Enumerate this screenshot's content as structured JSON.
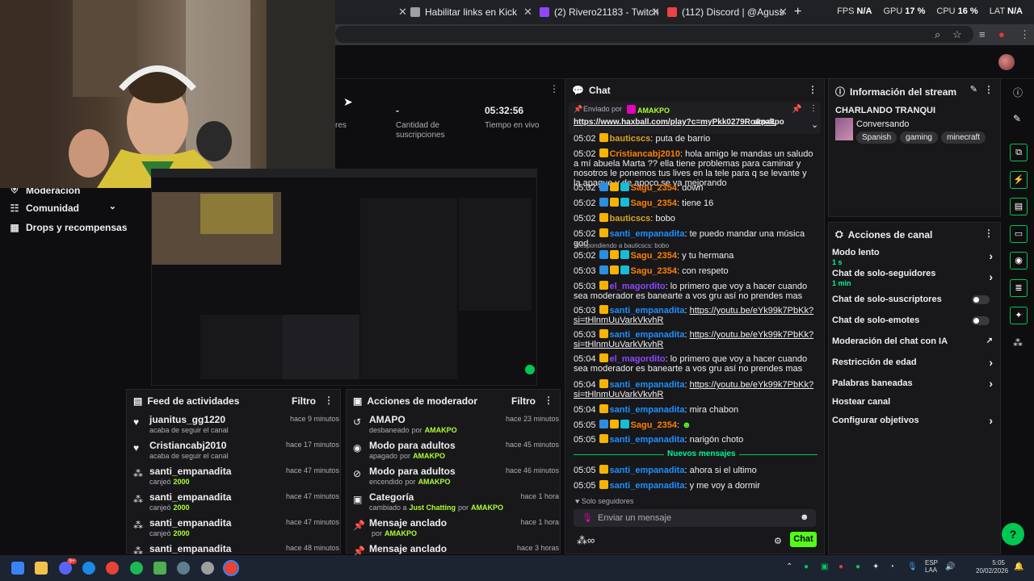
{
  "browser": {
    "tabs": [
      {
        "label": "Habilitar links en Kick",
        "color": "#9aa0a6"
      },
      {
        "label": "(2) Rivero21183 - Twitch",
        "color": "#9146ff"
      },
      {
        "label": "(112) Discord | @Aguss",
        "color": "#5865f2"
      }
    ],
    "new_tab_icon": "+",
    "perf": {
      "fps_label": "FPS",
      "fps": "N/A",
      "gpu_label": "GPU",
      "gpu": "17 %",
      "cpu_label": "CPU",
      "cpu": "16 %",
      "lat_label": "LAT",
      "lat": "N/A"
    }
  },
  "stats": {
    "subs_value": "-",
    "subs_label_1": "Cantidad de",
    "subs_label_2": "suscripciones",
    "live_value": "05:32:56",
    "live_label": "Tiempo en vivo",
    "partial_label": "res"
  },
  "nav": {
    "moderation": "Moderación",
    "community": "Comunidad",
    "drops": "Drops y recompensas"
  },
  "activity_feed": {
    "title": "Feed de actividades",
    "filter": "Filtro",
    "items": [
      {
        "icon": "heart-icon",
        "name": "juanitus_gg1220",
        "sub": "acaba de seguir el canal",
        "time": "hace 9 minutos"
      },
      {
        "icon": "heart-icon",
        "name": "Cristiancabj2010",
        "sub": "acaba de seguir el canal",
        "time": "hace 17 minutos"
      },
      {
        "icon": "points-icon",
        "name": "santi_empanadita",
        "sub": "canjeó",
        "amount": "2000",
        "time": "hace 47 minutos"
      },
      {
        "icon": "points-icon",
        "name": "santi_empanadita",
        "sub": "canjeó",
        "amount": "2000",
        "time": "hace 47 minutos"
      },
      {
        "icon": "points-icon",
        "name": "santi_empanadita",
        "sub": "canjeó",
        "amount": "2000",
        "time": "hace 47 minutos"
      },
      {
        "icon": "points-icon",
        "name": "santi_empanadita",
        "sub": "",
        "amount": "",
        "time": "hace 48 minutos"
      }
    ]
  },
  "mod_actions": {
    "title": "Acciones de moderador",
    "filter": "Filtro",
    "items": [
      {
        "icon": "undo-icon",
        "name": "AMAPO",
        "sub": "desbaneado",
        "by": "por",
        "who": "AMAKPO",
        "time": "hace 23 minutos"
      },
      {
        "icon": "eye-icon",
        "name": "Modo para adultos",
        "sub": "apagado",
        "by": "por",
        "who": "AMAKPO",
        "time": "hace 45 minutos"
      },
      {
        "icon": "eye-off-icon",
        "name": "Modo para adultos",
        "sub": "encendido",
        "by": "por",
        "who": "AMAKPO",
        "time": "hace 46 minutos"
      },
      {
        "icon": "category-icon",
        "name": "Categoría",
        "sub": "cambiado a",
        "extra": "Just Chatting",
        "by": "por",
        "who": "AMAKPO",
        "time": "hace 1 hora"
      },
      {
        "icon": "pin-icon",
        "name": "Mensaje anclado",
        "sub": "",
        "by": "por",
        "who": "AMAKPO",
        "time": "hace 1 hora"
      },
      {
        "icon": "pin-icon",
        "name": "Mensaje anclado",
        "sub": "",
        "by": "",
        "who": "",
        "time": "hace 3 horas"
      }
    ]
  },
  "chat": {
    "title": "Chat",
    "pinned_label": "Enviado por",
    "pinned_by": "AMAKPO",
    "pinned_link": "https://www.haxball.com/play?c=myPkk0279Ro&p=1",
    "pinned_text": "amakpo",
    "new_messages": "Nuevos mensajes",
    "reply_label": "Respondiendo a bauticscs: bobo",
    "followers_only": "Solo seguidores",
    "input_placeholder": "Enviar un mensaje",
    "send_label": "Chat",
    "messages": [
      {
        "t": "05:02",
        "u": "bauticscs",
        "c": "u-yellow",
        "b": [
          "b-sub"
        ],
        "m": "puta de barrio"
      },
      {
        "t": "05:02",
        "u": "Cristiancabj2010",
        "c": "u-orange",
        "b": [
          "b-sub"
        ],
        "m": "hola amigo le mandas un saludo a mí abuela Marta ?? ella tiene problemas para caminar y nosotros le ponemos tus lives en la tele para q se levante y la apague y de apoco se va mejorando"
      },
      {
        "t": "05:02",
        "u": "Sagu_2354",
        "c": "u-orange",
        "b": [
          "b-prime",
          "b-sub",
          "b-gift"
        ],
        "m": "down"
      },
      {
        "t": "05:02",
        "u": "Sagu_2354",
        "c": "u-orange",
        "b": [
          "b-prime",
          "b-sub",
          "b-gift"
        ],
        "m": "tiene 16"
      },
      {
        "t": "05:02",
        "u": "bauticscs",
        "c": "u-yellow",
        "b": [
          "b-sub"
        ],
        "m": "bobo"
      },
      {
        "t": "05:02",
        "u": "santi_empanadita",
        "c": "u-blue",
        "b": [
          "b-sub"
        ],
        "m": "te puedo mandar una música god"
      },
      {
        "t": "05:02",
        "u": "Sagu_2354",
        "c": "u-orange",
        "b": [
          "b-prime",
          "b-sub",
          "b-gift"
        ],
        "m": "y tu hermana"
      },
      {
        "t": "05:03",
        "u": "Sagu_2354",
        "c": "u-orange",
        "b": [
          "b-prime",
          "b-sub",
          "b-gift"
        ],
        "m": "con respeto"
      },
      {
        "t": "05:03",
        "u": "el_magordito",
        "c": "u-purple",
        "b": [
          "b-sub"
        ],
        "m": "lo primero que voy a hacer cuando sea moderador es banearte a vos gru así no prendes mas"
      },
      {
        "t": "05:03",
        "u": "santi_empanadita",
        "c": "u-blue",
        "b": [
          "b-sub"
        ],
        "m": "https://youtu.be/eYk99k7PbKk?si=tHlnmUuVarkVkvhR"
      },
      {
        "t": "05:03",
        "u": "santi_empanadita",
        "c": "u-blue",
        "b": [
          "b-sub"
        ],
        "m": "https://youtu.be/eYk99k7PbKk?si=tHlnmUuVarkVkvhR"
      },
      {
        "t": "05:04",
        "u": "el_magordito",
        "c": "u-purple",
        "b": [
          "b-sub"
        ],
        "m": "lo primero que voy a hacer cuando sea moderador es banearte a vos gru así no prendes mas"
      },
      {
        "t": "05:04",
        "u": "santi_empanadita",
        "c": "u-blue",
        "b": [
          "b-sub"
        ],
        "m": "https://youtu.be/eYk99k7PbKk?si=tHlnmUuVarkVkvhR"
      },
      {
        "t": "05:04",
        "u": "santi_empanadita",
        "c": "u-blue",
        "b": [
          "b-sub"
        ],
        "m": "mira chabon"
      },
      {
        "t": "05:05",
        "u": "Sagu_2354",
        "c": "u-orange",
        "b": [
          "b-prime",
          "b-sub",
          "b-gift"
        ],
        "m": ""
      },
      {
        "t": "05:05",
        "u": "santi_empanadita",
        "c": "u-blue",
        "b": [
          "b-sub"
        ],
        "m": "narigón choto"
      },
      {
        "t": "05:05",
        "u": "santi_empanadita",
        "c": "u-blue",
        "b": [
          "b-sub"
        ],
        "m": "ahora si el ultimo"
      },
      {
        "t": "05:05",
        "u": "santi_empanadita",
        "c": "u-blue",
        "b": [
          "b-sub"
        ],
        "m": "y me voy a dormir"
      }
    ]
  },
  "stream_info": {
    "title": "Información del stream",
    "stream_title": "CHARLANDO TRANQUI",
    "category": "Conversando",
    "tags": [
      "Spanish",
      "gaming",
      "minecraft"
    ]
  },
  "channel_actions": {
    "title": "Acciones de canal",
    "items": [
      {
        "label": "Modo lento",
        "sub": "1 s",
        "control": "chevron"
      },
      {
        "label": "Chat de solo-seguidores",
        "sub": "1 min",
        "control": "chevron"
      },
      {
        "label": "Chat de solo-suscriptores",
        "sub": "",
        "control": "toggle"
      },
      {
        "label": "Chat de solo-emotes",
        "sub": "",
        "control": "toggle"
      },
      {
        "label": "Moderación del chat con IA",
        "sub": "",
        "control": "external"
      },
      {
        "label": "Restricción de edad",
        "sub": "",
        "control": "chevron"
      },
      {
        "label": "Palabras baneadas",
        "sub": "",
        "control": "chevron"
      },
      {
        "label": "Hostear canal",
        "sub": "",
        "control": "none"
      },
      {
        "label": "Configurar objetivos",
        "sub": "",
        "control": "chevron"
      }
    ]
  },
  "taskbar": {
    "lang": "ESP",
    "lang2": "LAA",
    "time": "5:05",
    "date": "20/02/2026",
    "discord_badge": "9+"
  }
}
